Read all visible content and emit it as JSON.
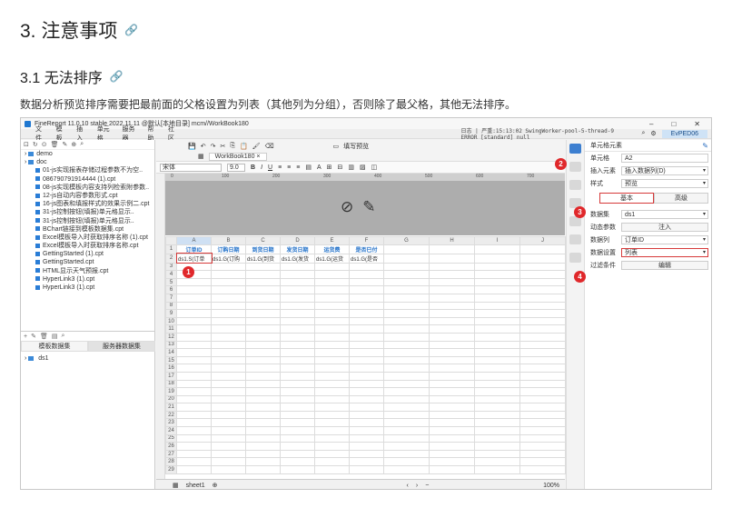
{
  "doc": {
    "section_title": "3. 注意事项",
    "subsection_title": "3.1 无法排序",
    "paragraph": "数据分析预览排序需要把最前面的父格设置为列表（其他列为分组），否则除了最父格，其他无法排序。"
  },
  "app": {
    "title": "FineReport 11.0.10 stable 2022.11.11 @默认[本地目录]   mcm//WorkBook180",
    "window_controls": [
      "–",
      "□",
      "✕"
    ],
    "menu": [
      "文件",
      "模板",
      "插入",
      "单元格",
      "服务器",
      "帮助",
      "社区"
    ],
    "log_text": "日志 | 严重:15:13:02 SwingWorker-pool-5-thread-9 ERROR [standard] null",
    "user": "EvPED06"
  },
  "left_panel": {
    "tree": [
      {
        "label": "demo",
        "type": "folder"
      },
      {
        "label": "doc",
        "type": "folder"
      },
      {
        "label": "01-js实现报表存储过程参数不为空..",
        "type": "file"
      },
      {
        "label": "086790791914444 (1).cpt",
        "type": "file"
      },
      {
        "label": "08-js实现模板内容支持列检索附参数..",
        "type": "file"
      },
      {
        "label": "12-js自动内容参数形式.cpt",
        "type": "file"
      },
      {
        "label": "16-js图表和填报样式的效果示例二.cpt",
        "type": "file"
      },
      {
        "label": "31-js控制按钮(填报)单元格显示..",
        "type": "file"
      },
      {
        "label": "31-js控制按钮(填报)单元格显示..",
        "type": "file"
      },
      {
        "label": "BChart链接到模板数据集.cpt",
        "type": "file"
      },
      {
        "label": "Excel模板导入时获取排序名称 (1).cpt",
        "type": "file"
      },
      {
        "label": "Excel模板导入时获取排序名称.cpt",
        "type": "file"
      },
      {
        "label": "GettingStarted (1).cpt",
        "type": "file"
      },
      {
        "label": "GettingStarted.cpt",
        "type": "file"
      },
      {
        "label": "HTML显示天气预报.cpt",
        "type": "file"
      },
      {
        "label": "HyperLink3 (1).cpt",
        "type": "file"
      },
      {
        "label": "HyperLink3 (1).cpt",
        "type": "file"
      }
    ],
    "tabs": [
      "模板数据集",
      "服务器数据集"
    ],
    "dataset": "ds1"
  },
  "center": {
    "workbook_tab": "WorkBook180",
    "preview_label": "填写预览",
    "font_name": "宋体",
    "font_size": "9.0",
    "ruler_marks": [
      "0",
      "100",
      "200",
      "300",
      "400",
      "500",
      "600",
      "700"
    ],
    "columns": [
      "A",
      "B",
      "C",
      "D",
      "E",
      "F",
      "G",
      "H",
      "I",
      "J",
      "K"
    ],
    "headers": [
      "订单ID",
      "订购日期",
      "到货日期",
      "发货日期",
      "运货费",
      "是否已付"
    ],
    "row1_values": [
      "ds1.S(订单",
      "ds1.G(订购",
      "ds1.G(到货",
      "ds1.G(发货",
      "ds1.G(运货",
      "ds1.G(是否"
    ],
    "row_count": 29,
    "sheet_name": "sheet1",
    "zoom": "100",
    "zoom_unit": "%"
  },
  "props": {
    "title": "单元格元素",
    "cell_label": "单元格",
    "cell_value": "A2",
    "insert_label": "插入元素",
    "insert_value": "插入数据列(D)",
    "style_label": "样式",
    "style_value": "预览",
    "tabs": [
      "基本",
      "高级"
    ],
    "dataset_label": "数据集",
    "dataset_value": "ds1",
    "dynamic_param_label": "动态参数",
    "dynamic_param_btn": "注入",
    "data_col_label": "数据列",
    "data_col_value": "订单ID",
    "data_setting_label": "数据设置",
    "data_setting_value": "列表",
    "filter_label": "过滤条件",
    "filter_btn": "编辑"
  },
  "markers": [
    "1",
    "2",
    "3",
    "4"
  ],
  "colors": {
    "accent_blue": "#1f6fc8",
    "marker_red": "#e0282b",
    "header_area_gray": "#adadad"
  }
}
